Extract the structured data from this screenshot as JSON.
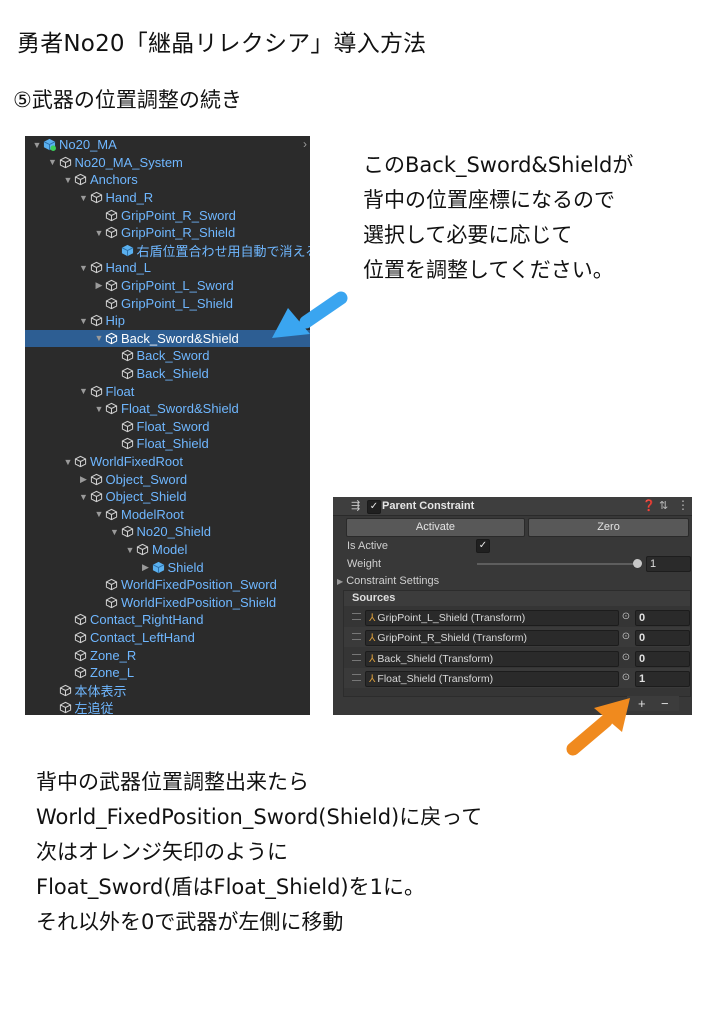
{
  "title": "勇者No20「継晶リレクシア」導入方法",
  "subtitle": "⑤武器の位置調整の続き",
  "note_right": "このBack_Sword&Shieldが\n背中の位置座標になるので\n選択して必要に応じて\n位置を調整してください。",
  "note_bottom": "背中の武器位置調整出来たら\nWorld_FixedPosition_Sword(Shield)に戻って\n次はオレンジ矢印のように\nFloat_Sword(盾はFloat_Shield)を1に。\nそれ以外を0で武器が左側に移動",
  "hierarchy": {
    "rows": [
      {
        "label": "No20_MA",
        "expand": "open"
      },
      {
        "label": "No20_MA_System",
        "expand": "open"
      },
      {
        "label": "Anchors",
        "expand": "open"
      },
      {
        "label": "Hand_R",
        "expand": "open"
      },
      {
        "label": "GripPoint_R_Sword",
        "expand": "none"
      },
      {
        "label": "GripPoint_R_Shield",
        "expand": "open"
      },
      {
        "label": "右盾位置合わせ用自動で消える",
        "expand": "none"
      },
      {
        "label": "Hand_L",
        "expand": "open"
      },
      {
        "label": "GripPoint_L_Sword",
        "expand": "closed"
      },
      {
        "label": "GripPoint_L_Shield",
        "expand": "none"
      },
      {
        "label": "Hip",
        "expand": "open"
      },
      {
        "label": "Back_Sword&Shield",
        "expand": "open",
        "selected": true
      },
      {
        "label": "Back_Sword",
        "expand": "none"
      },
      {
        "label": "Back_Shield",
        "expand": "none"
      },
      {
        "label": "Float",
        "expand": "open"
      },
      {
        "label": "Float_Sword&Shield",
        "expand": "open"
      },
      {
        "label": "Float_Sword",
        "expand": "none"
      },
      {
        "label": "Float_Shield",
        "expand": "none"
      },
      {
        "label": "WorldFixedRoot",
        "expand": "open"
      },
      {
        "label": "Object_Sword",
        "expand": "closed"
      },
      {
        "label": "Object_Shield",
        "expand": "open"
      },
      {
        "label": "ModelRoot",
        "expand": "open"
      },
      {
        "label": "No20_Shield",
        "expand": "open"
      },
      {
        "label": "Model",
        "expand": "open"
      },
      {
        "label": "Shield",
        "expand": "closed"
      },
      {
        "label": "WorldFixedPosition_Sword",
        "expand": "none"
      },
      {
        "label": "WorldFixedPosition_Shield",
        "expand": "none"
      },
      {
        "label": "Contact_RightHand",
        "expand": "none"
      },
      {
        "label": "Contact_LeftHand",
        "expand": "none"
      },
      {
        "label": "Zone_R",
        "expand": "none"
      },
      {
        "label": "Zone_L",
        "expand": "none"
      },
      {
        "label": "本体表示",
        "expand": "none"
      },
      {
        "label": "左追従",
        "expand": "none"
      }
    ]
  },
  "inspector": {
    "component_title": "Parent Constraint",
    "activate_label": "Activate",
    "zero_label": "Zero",
    "is_active_label": "Is Active",
    "is_active_check": "✓",
    "weight_label": "Weight",
    "weight_value": "1",
    "constraint_settings_label": "Constraint Settings",
    "sources_label": "Sources",
    "sources": [
      {
        "name": "GripPoint_L_Shield (Transform)",
        "weight": "0"
      },
      {
        "name": "GripPoint_R_Shield (Transform)",
        "weight": "0"
      },
      {
        "name": "Back_Shield (Transform)",
        "weight": "0"
      },
      {
        "name": "Float_Shield (Transform)",
        "weight": "1"
      }
    ],
    "plus_label": "+",
    "minus_label": "−"
  },
  "colors": {
    "hier_text": "#6fb7ff",
    "selection": "#2d5e93",
    "blue_arrow": "#3aa5f0",
    "orange_arrow": "#f08a1e"
  }
}
